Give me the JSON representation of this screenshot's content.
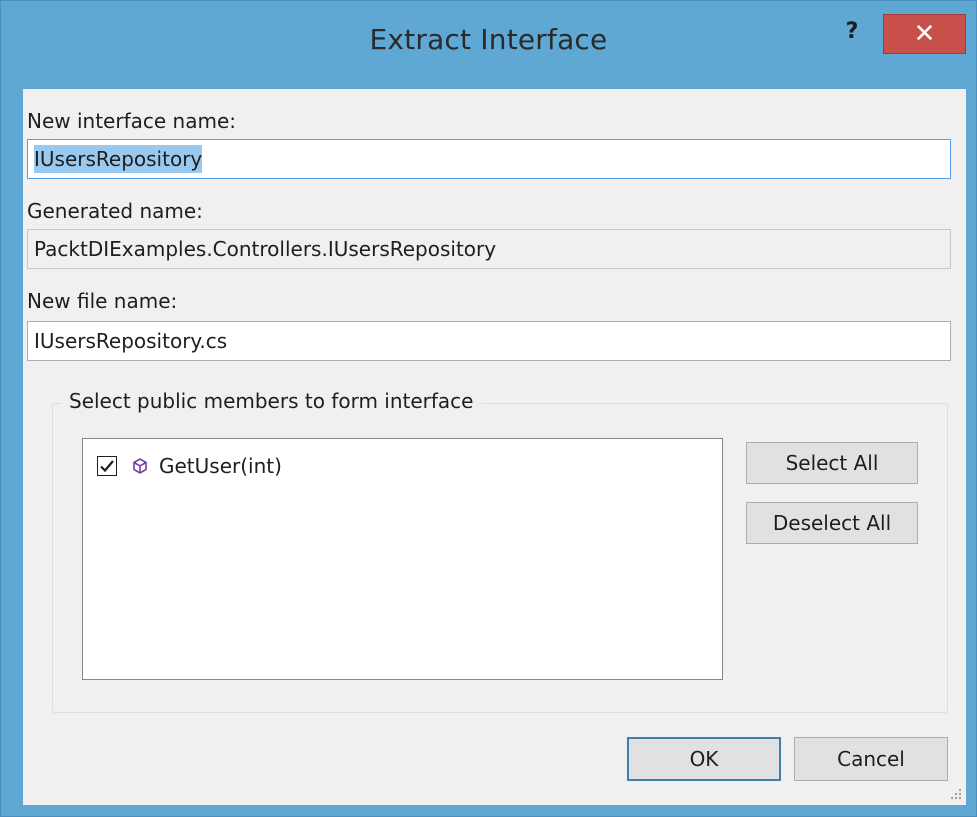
{
  "window": {
    "title": "Extract Interface",
    "help_glyph": "?",
    "close_glyph": "✕"
  },
  "form": {
    "interface_name_label": "New interface name:",
    "interface_name_value": "IUsersRepository",
    "generated_name_label": "Generated name:",
    "generated_name_value": "PacktDIExamples.Controllers.IUsersRepository",
    "file_name_label": "New file name:",
    "file_name_value": "IUsersRepository.cs"
  },
  "members": {
    "group_label": "Select public members to form interface",
    "items": [
      {
        "label": "GetUser(int)",
        "checked": true,
        "icon": "method-cube-icon"
      }
    ],
    "select_all_label": "Select All",
    "deselect_all_label": "Deselect All"
  },
  "actions": {
    "ok_label": "OK",
    "cancel_label": "Cancel"
  },
  "colors": {
    "titlebar": "#5fa8d3",
    "close_button": "#c7504a",
    "selection_highlight": "#99c9ef",
    "method_icon": "#7a3ea8"
  }
}
